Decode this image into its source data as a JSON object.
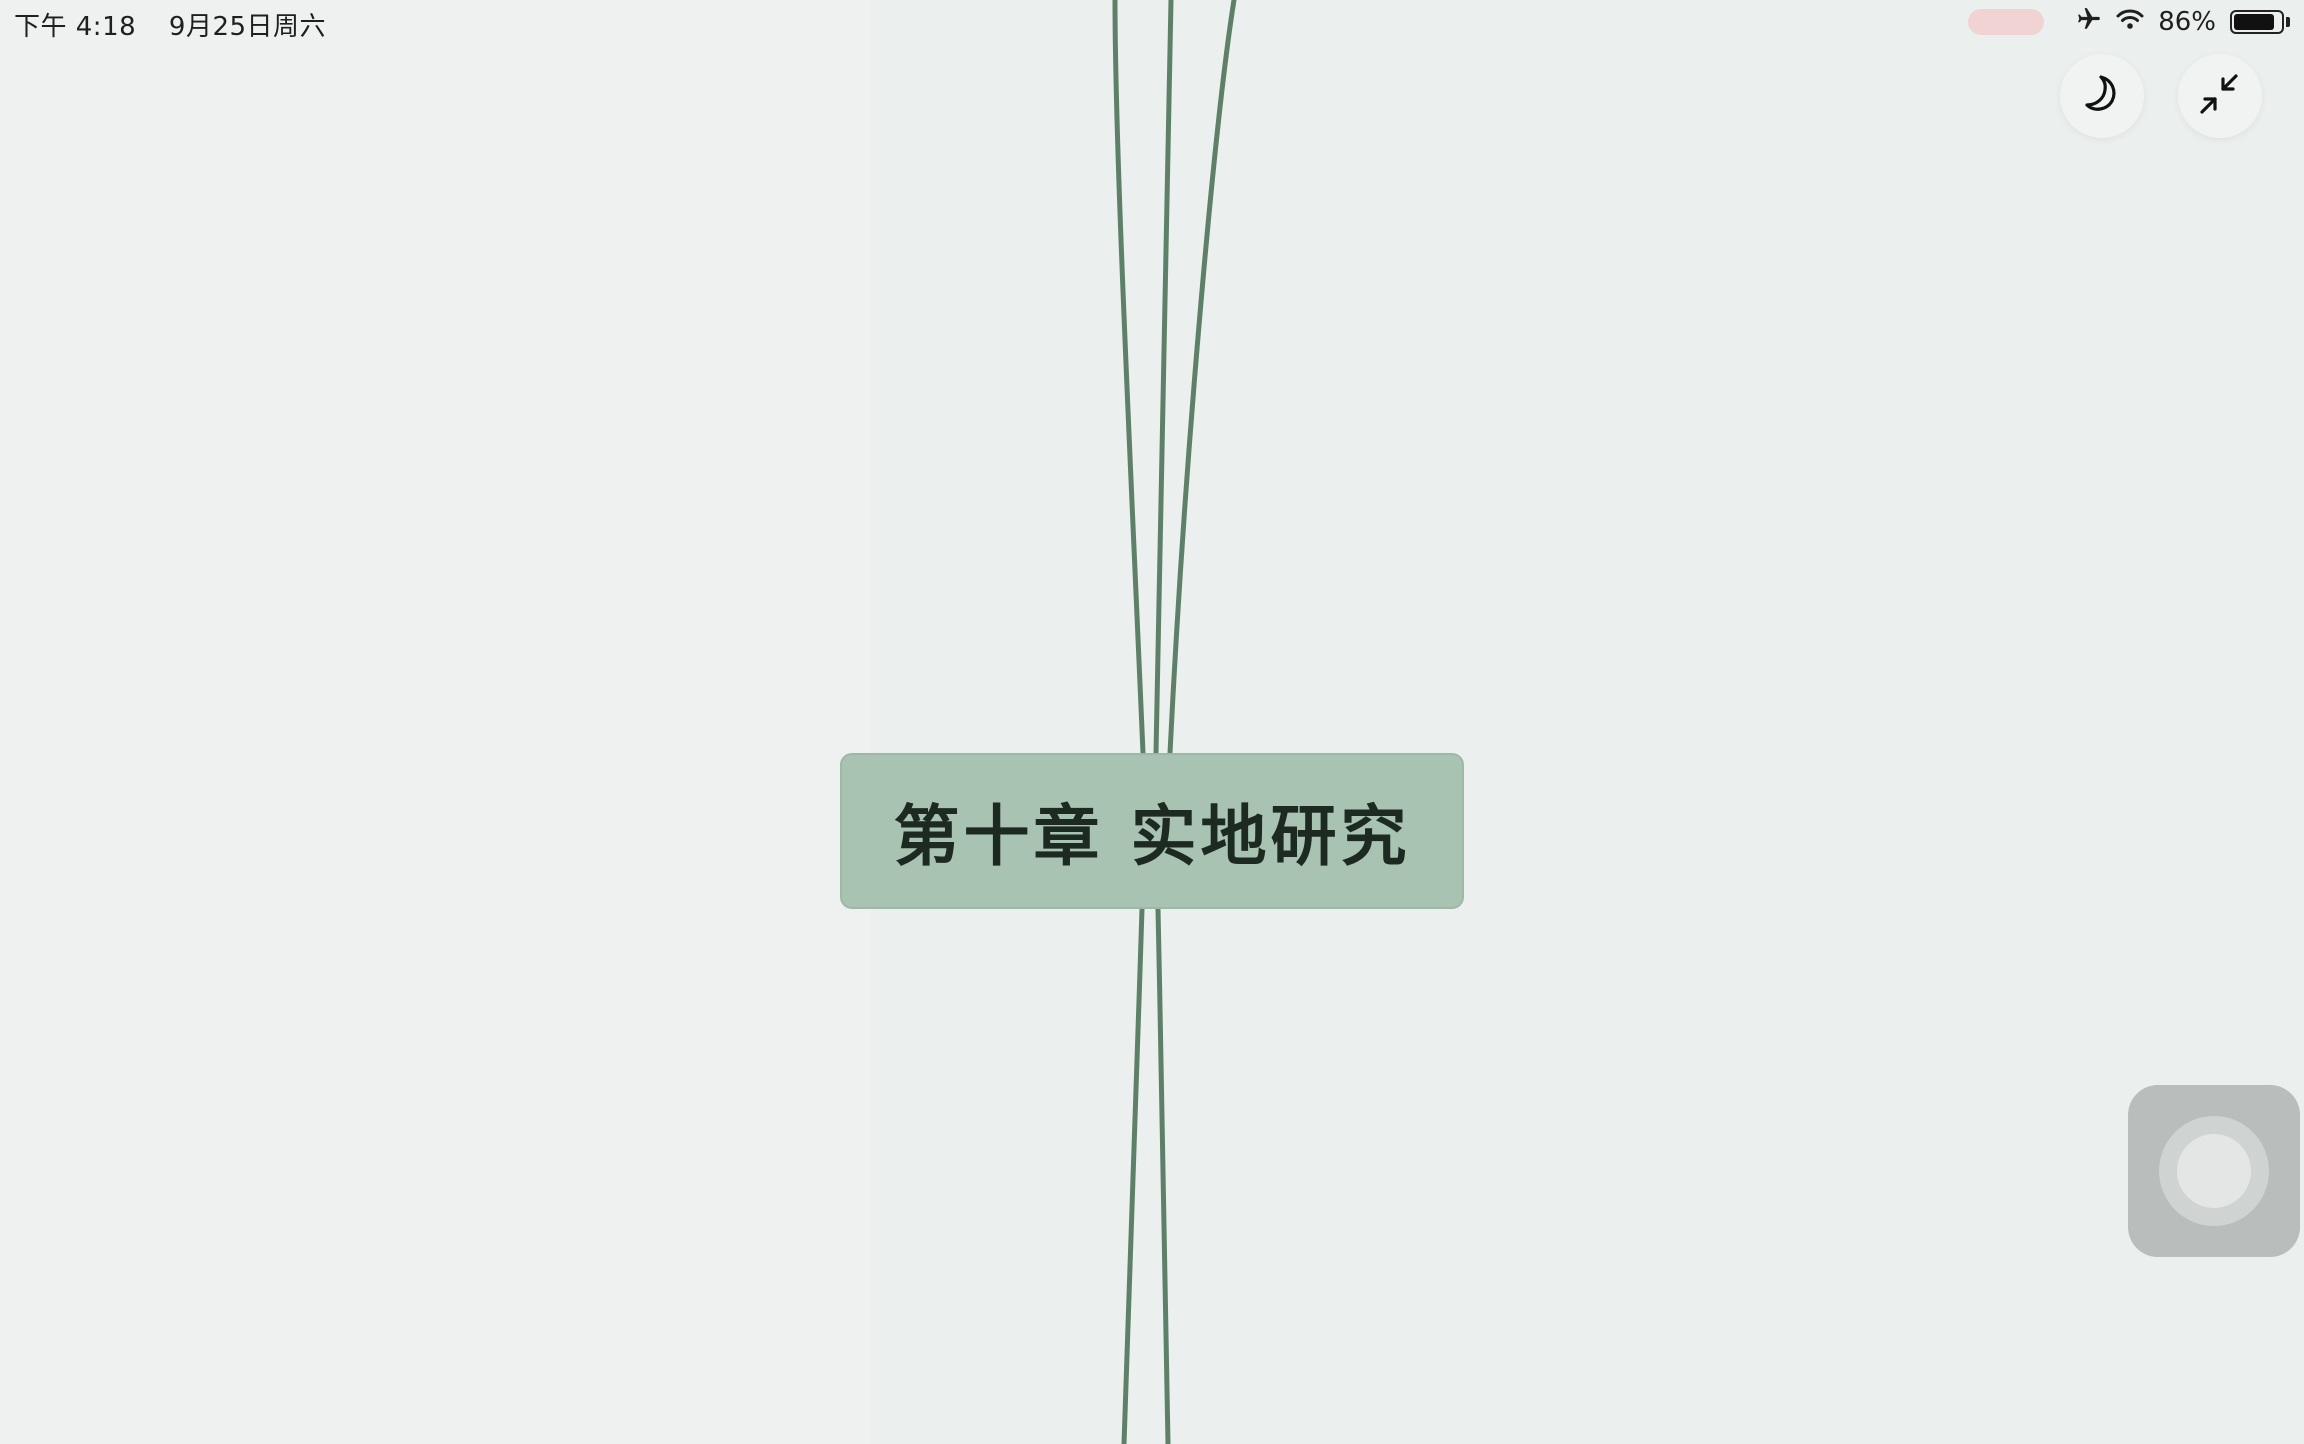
{
  "status_bar": {
    "time": "下午 4:18",
    "date": "9月25日周六",
    "battery_percent": "86%",
    "battery_level": 0.86,
    "icons": [
      "airplane-icon",
      "wifi-icon",
      "battery-icon"
    ],
    "recording_indicator_color": "#f2d3d3"
  },
  "toolbar": {
    "buttons": [
      {
        "name": "night-mode-button",
        "icon": "moon-icon"
      },
      {
        "name": "exit-fullscreen-button",
        "icon": "collapse-arrows-icon"
      }
    ]
  },
  "mindmap": {
    "central_node": {
      "title": "第十章 实地研究",
      "fill_color": "#a9c3b2"
    },
    "connector_color": "#5e8068"
  },
  "assistive_touch": {
    "icon": "assistive-touch-icon"
  }
}
